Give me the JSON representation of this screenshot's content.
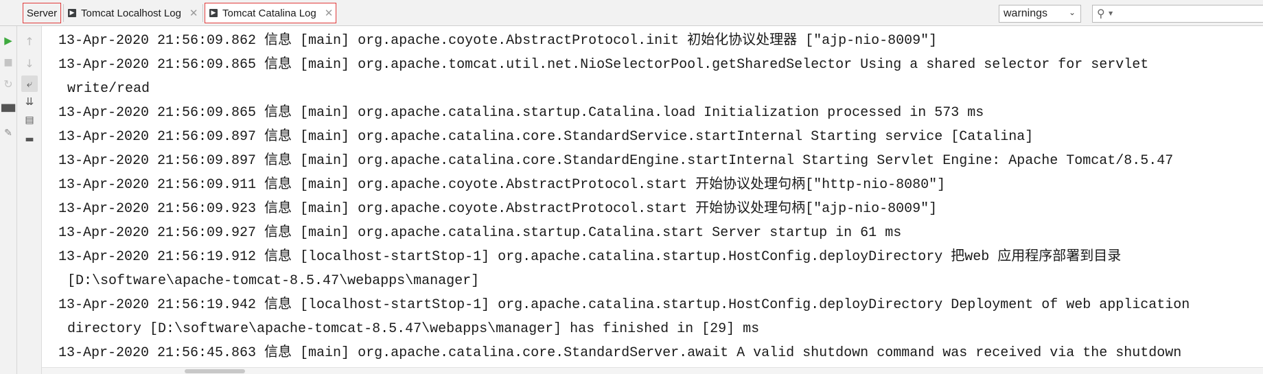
{
  "tabs": [
    {
      "label": "Server",
      "icon": "none"
    },
    {
      "label": "Tomcat Localhost Log",
      "icon": "console-icon",
      "close": "✕"
    },
    {
      "label": "Tomcat Catalina Log",
      "icon": "console-icon",
      "close": "✕"
    }
  ],
  "filter": {
    "selected": "warnings"
  },
  "search": {
    "value": ""
  },
  "log_lines": [
    {
      "text": "13-Apr-2020 21:56:09.862 信息 [main] org.apache.coyote.AbstractProtocol.init 初始化协议处理器 [\"ajp-nio-8009\"]"
    },
    {
      "text": "13-Apr-2020 21:56:09.865 信息 [main] org.apache.tomcat.util.net.NioSelectorPool.getSharedSelector Using a shared selector for servlet"
    },
    {
      "text": "write/read",
      "continuation": true
    },
    {
      "text": "13-Apr-2020 21:56:09.865 信息 [main] org.apache.catalina.startup.Catalina.load Initialization processed in 573 ms"
    },
    {
      "text": "13-Apr-2020 21:56:09.897 信息 [main] org.apache.catalina.core.StandardService.startInternal Starting service [Catalina]"
    },
    {
      "text": "13-Apr-2020 21:56:09.897 信息 [main] org.apache.catalina.core.StandardEngine.startInternal Starting Servlet Engine: Apache Tomcat/8.5.47"
    },
    {
      "text": "13-Apr-2020 21:56:09.911 信息 [main] org.apache.coyote.AbstractProtocol.start 开始协议处理句柄[\"http-nio-8080\"]"
    },
    {
      "text": "13-Apr-2020 21:56:09.923 信息 [main] org.apache.coyote.AbstractProtocol.start 开始协议处理句柄[\"ajp-nio-8009\"]"
    },
    {
      "text": "13-Apr-2020 21:56:09.927 信息 [main] org.apache.catalina.startup.Catalina.start Server startup in 61 ms"
    },
    {
      "text": "13-Apr-2020 21:56:19.912 信息 [localhost-startStop-1] org.apache.catalina.startup.HostConfig.deployDirectory 把web 应用程序部署到目录"
    },
    {
      "text": "[D:\\software\\apache-tomcat-8.5.47\\webapps\\manager]",
      "continuation": true
    },
    {
      "text": "13-Apr-2020 21:56:19.942 信息 [localhost-startStop-1] org.apache.catalina.startup.HostConfig.deployDirectory Deployment of web application"
    },
    {
      "text": "directory [D:\\software\\apache-tomcat-8.5.47\\webapps\\manager] has finished in [29] ms",
      "continuation": true
    },
    {
      "text": "13-Apr-2020 21:56:45.863 信息 [main] org.apache.catalina.core.StandardServer.await A valid shutdown command was received via the shutdown"
    }
  ],
  "colors": {
    "accent": "#e03a3a",
    "run_green": "#3faa3f"
  }
}
